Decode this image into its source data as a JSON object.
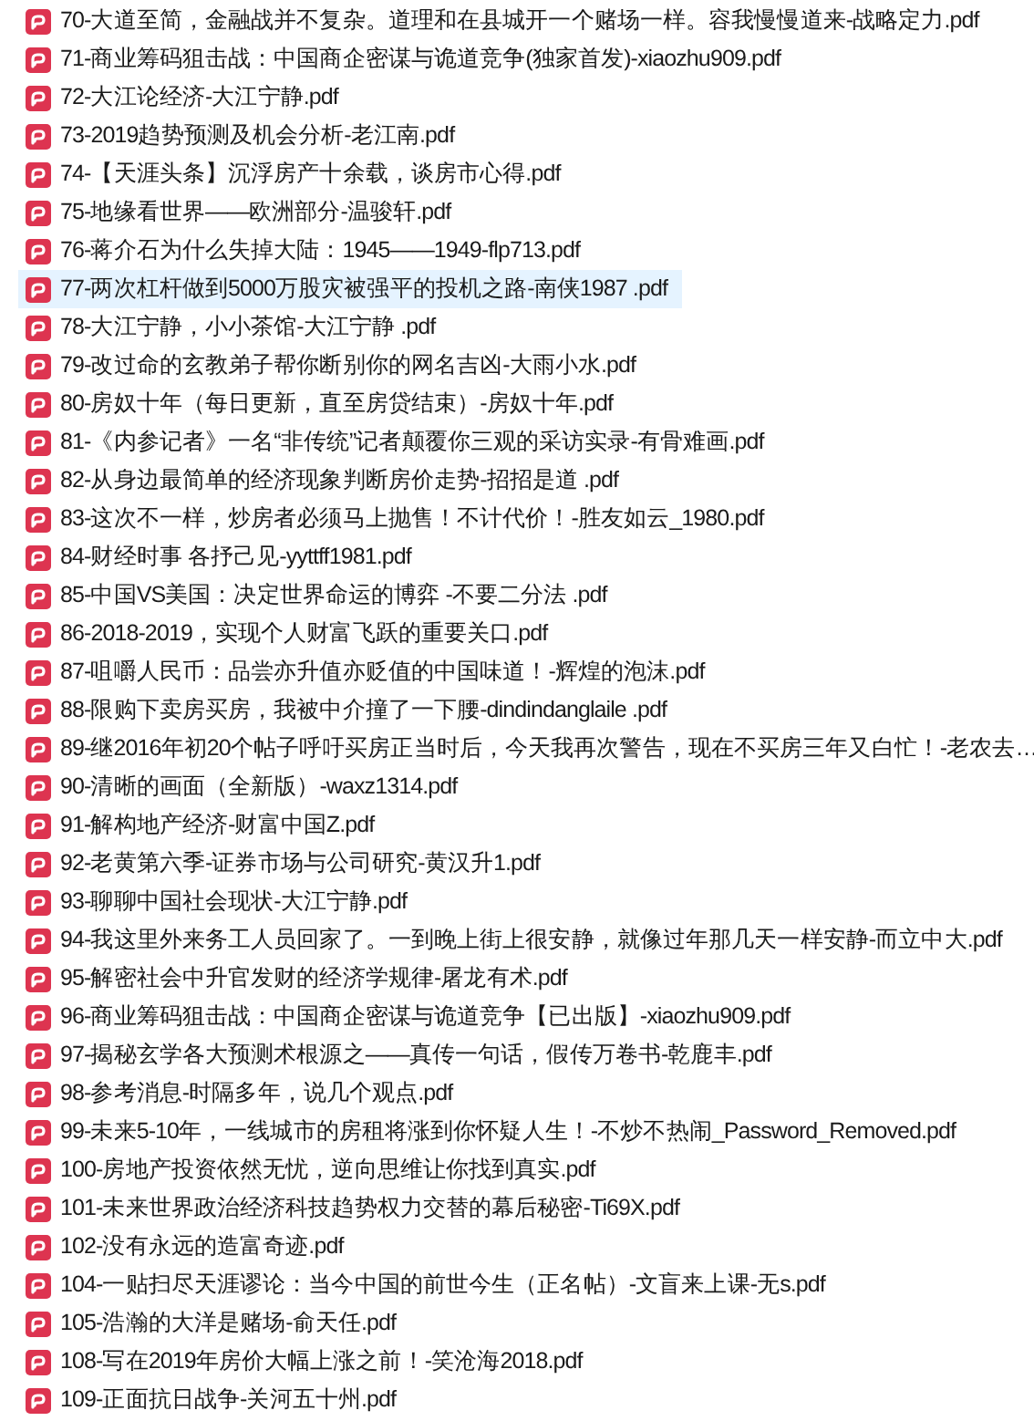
{
  "files": [
    {
      "name": "70-大道至简，金融战并不复杂。道理和在县城开一个赌场一样。容我慢慢道来-战略定力.pdf",
      "selected": false
    },
    {
      "name": "71-商业筹码狙击战：中国商企密谋与诡道竞争(独家首发)-xiaozhu909.pdf",
      "selected": false
    },
    {
      "name": "72-大江论经济-大江宁静.pdf",
      "selected": false
    },
    {
      "name": "73-2019趋势预测及机会分析-老江南.pdf",
      "selected": false
    },
    {
      "name": "74-【天涯头条】沉浮房产十余载，谈房市心得.pdf",
      "selected": false
    },
    {
      "name": "75-地缘看世界——欧洲部分-温骏轩.pdf",
      "selected": false
    },
    {
      "name": "76-蒋介石为什么失掉大陆：1945——1949-flp713.pdf",
      "selected": false
    },
    {
      "name": "77-两次杠杆做到5000万股灾被强平的投机之路-南侠1987 .pdf",
      "selected": true
    },
    {
      "name": "78-大江宁静，小小茶馆-大江宁静 .pdf",
      "selected": false
    },
    {
      "name": "79-改过命的玄教弟子帮你断别你的网名吉凶-大雨小水.pdf",
      "selected": false
    },
    {
      "name": "80-房奴十年（每日更新，直至房贷结束）-房奴十年.pdf",
      "selected": false
    },
    {
      "name": "81-《内参记者》一名“非传统”记者颠覆你三观的采访实录-有骨难画.pdf",
      "selected": false
    },
    {
      "name": "82-从身边最简单的经济现象判断房价走势-招招是道 .pdf",
      "selected": false
    },
    {
      "name": "83-这次不一样，炒房者必须马上抛售！不计代价！-胜友如云_1980.pdf",
      "selected": false
    },
    {
      "name": "84-财经时事 各抒己见-yyttff1981.pdf",
      "selected": false
    },
    {
      "name": "85-中国VS美国：决定世界命运的博弈 -不要二分法 .pdf",
      "selected": false
    },
    {
      "name": "86-2018-2019，实现个人财富飞跃的重要关口.pdf",
      "selected": false
    },
    {
      "name": "87-咀嚼人民币：品尝亦升值亦贬值的中国味道！-辉煌的泡沫.pdf",
      "selected": false
    },
    {
      "name": "88-限购下卖房买房，我被中介撞了一下腰-dindindanglaile .pdf",
      "selected": false
    },
    {
      "name": "89-继2016年初20个帖子呼吁买房正当时后，今天我再次警告，现在不买房三年又白忙！-老农去…",
      "selected": false
    },
    {
      "name": "90-清晰的画面（全新版）-waxz1314.pdf",
      "selected": false
    },
    {
      "name": "91-解构地产经济-财富中国Z.pdf",
      "selected": false
    },
    {
      "name": "92-老黄第六季-证券市场与公司研究-黄汉升1.pdf",
      "selected": false
    },
    {
      "name": "93-聊聊中国社会现状-大江宁静.pdf",
      "selected": false
    },
    {
      "name": "94-我这里外来务工人员回家了。一到晚上街上很安静，就像过年那几天一样安静-而立中大.pdf",
      "selected": false
    },
    {
      "name": "95-解密社会中升官发财的经济学规律-屠龙有术.pdf",
      "selected": false
    },
    {
      "name": "96-商业筹码狙击战：中国商企密谋与诡道竞争【已出版】-xiaozhu909.pdf",
      "selected": false
    },
    {
      "name": "97-揭秘玄学各大预测术根源之——真传一句话，假传万卷书-乾鹿丰.pdf",
      "selected": false
    },
    {
      "name": "98-参考消息-时隔多年，说几个观点.pdf",
      "selected": false
    },
    {
      "name": "99-未来5-10年，一线城市的房租将涨到你怀疑人生！-不炒不热闹_Password_Removed.pdf",
      "selected": false
    },
    {
      "name": "100-房地产投资依然无忧，逆向思维让你找到真实.pdf",
      "selected": false
    },
    {
      "name": "101-未来世界政治经济科技趋势权力交替的幕后秘密-Ti69X.pdf",
      "selected": false
    },
    {
      "name": "102-没有永远的造富奇迹.pdf",
      "selected": false
    },
    {
      "name": "104-一贴扫尽天涯谬论：当今中国的前世今生（正名帖）-文盲来上课-无s.pdf",
      "selected": false
    },
    {
      "name": "105-浩瀚的大洋是赌场-俞天任.pdf",
      "selected": false
    },
    {
      "name": "108-写在2019年房价大幅上涨之前！-笑沧海2018.pdf",
      "selected": false
    },
    {
      "name": "109-正面抗日战争-关河五十州.pdf",
      "selected": false
    }
  ]
}
